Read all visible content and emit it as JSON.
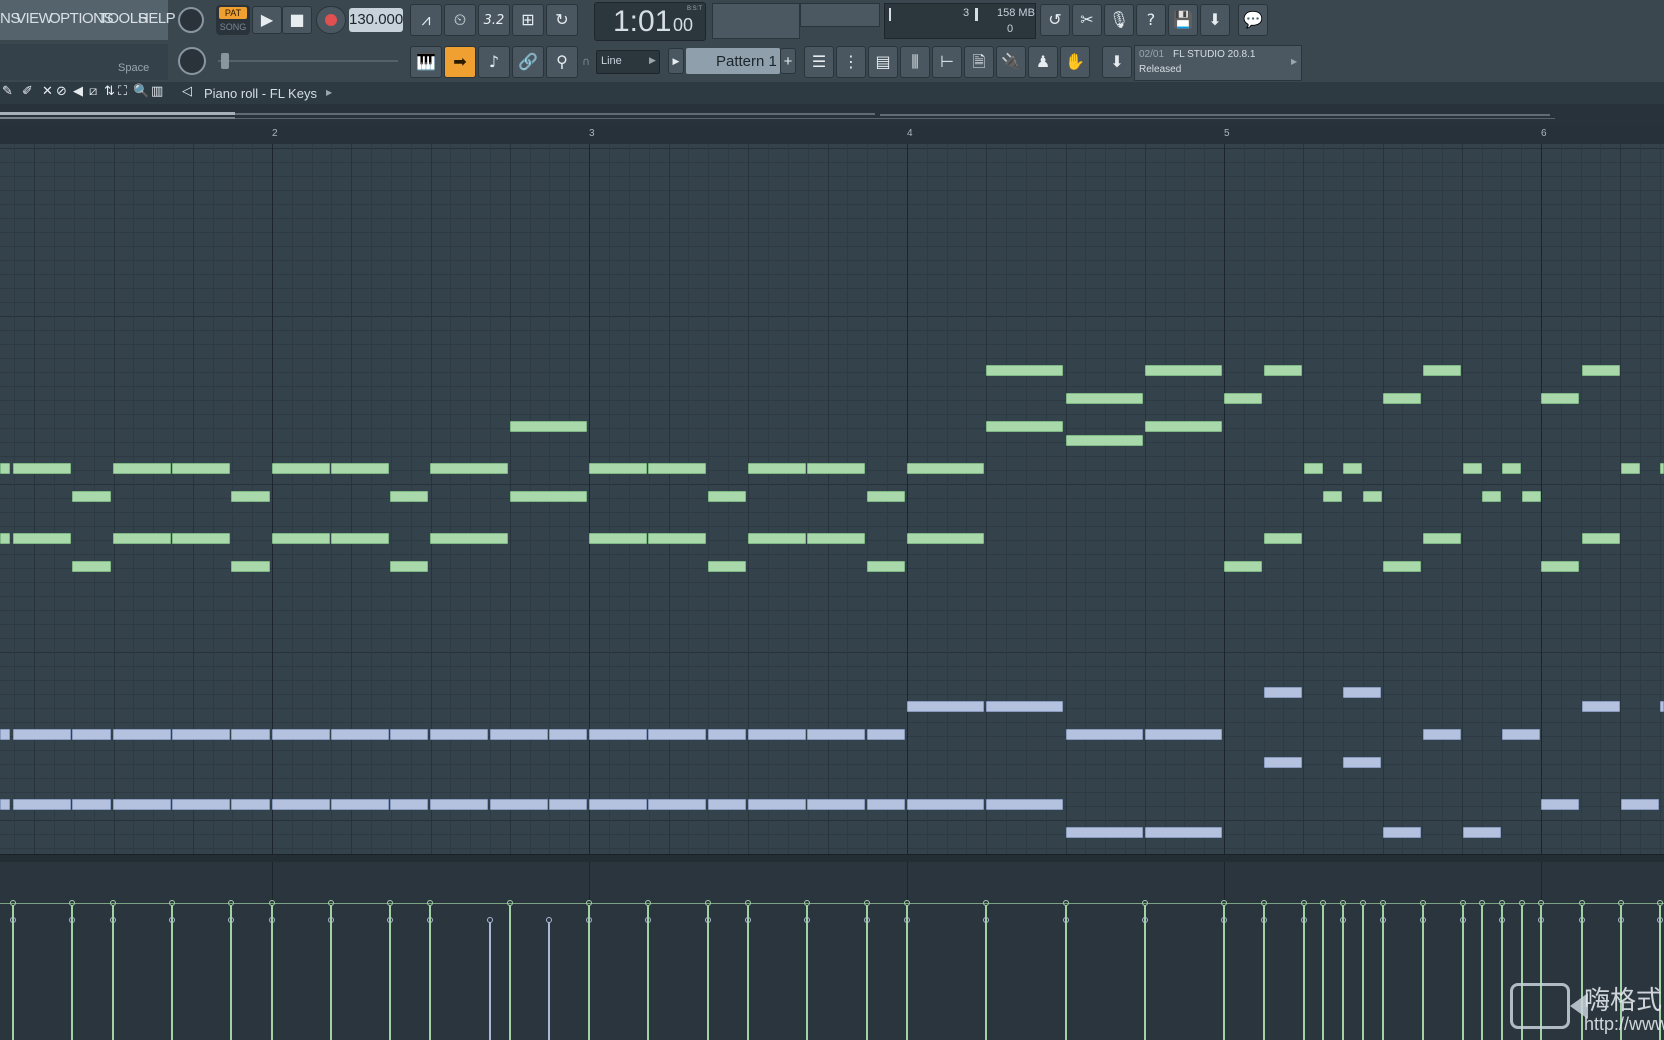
{
  "menu": [
    "NS",
    "VIEW",
    "OPTIONS",
    "TOOLS",
    "HELP"
  ],
  "transport": {
    "pat_label": "PAT",
    "song_label": "SONG",
    "tempo": "130.000",
    "time_display": "1:01",
    "time_sub": "00",
    "time_unit": "B:S:T"
  },
  "hint_key": "Space",
  "monitor": {
    "cpu_value": "3",
    "memory": "158 MB",
    "polyphony": "0"
  },
  "snap_mode": "Line",
  "pattern": "Pattern 1",
  "news": {
    "date": "02/01",
    "title": "FL STUDIO 20.8.1",
    "status": "Released"
  },
  "piano_roll_title": "Piano roll - FL Keys",
  "ruler": [
    "2",
    "3",
    "4",
    "5",
    "6"
  ],
  "watermark": {
    "brand": "嗨格式",
    "url": "http://www"
  },
  "colors": {
    "green_note": "#a9d8ab",
    "blue_note": "#b4c2df",
    "accent_orange": "#f0a030"
  }
}
